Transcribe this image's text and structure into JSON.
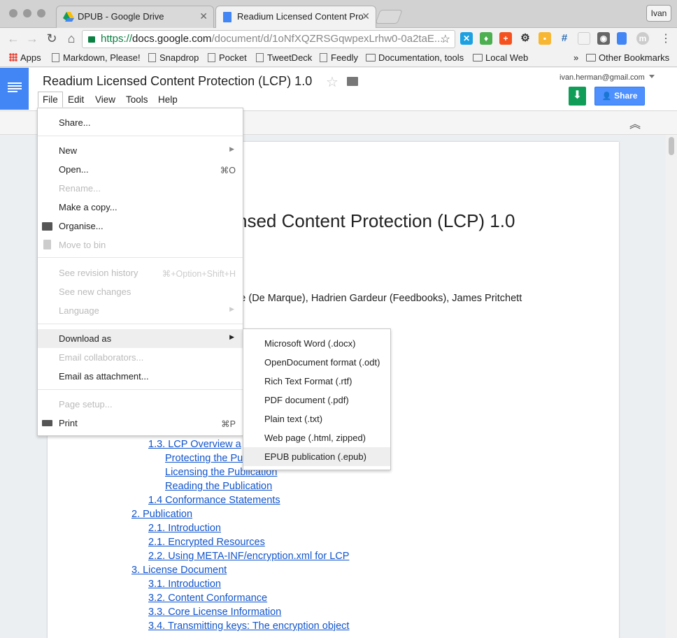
{
  "browser": {
    "tabs": [
      {
        "title": "DPUB - Google Drive"
      },
      {
        "title": "Readium Licensed Content Pro"
      }
    ],
    "user": "Ivan",
    "url": {
      "scheme": "https://",
      "host": "docs.google.com",
      "path": "/document/d/1oNfXQZRSGqwpexLrhw0-0a2taE..."
    },
    "bookmarks": [
      "Apps",
      "Markdown, Please!",
      "Snapdrop",
      "Pocket",
      "TweetDeck",
      "Feedly",
      "Documentation, tools",
      "Local Web"
    ],
    "bookmarks_overflow": "»",
    "other_bookmarks": "Other Bookmarks"
  },
  "docs": {
    "title": "Readium Licensed Content Protection (LCP) 1.0",
    "menus": [
      "File",
      "Edit",
      "View",
      "Tools",
      "Help"
    ],
    "account": "ivan.herman@gmail.com",
    "share_label": "Share"
  },
  "document": {
    "heading": "nsed Content Protection (LCP) 1.0",
    "authors": "gie (De Marque), Hadrien Gardeur (Feedbooks), James Pritchett",
    "toc": [
      "1.3. LCP Overview a",
      "Protecting the Pu",
      "Licensing the Publication",
      "Reading the Publication",
      "1.4 Conformance Statements",
      "2. Publication",
      "2.1. Introduction",
      "2.1. Encrypted Resources",
      "2.2. Using META-INF/encryption.xml for LCP",
      "3. License Document",
      "3.1. Introduction",
      "3.2. Content Conformance",
      "3.3. Core License Information",
      "3.4. Transmitting keys:  The encryption object"
    ]
  },
  "file_menu": {
    "items": [
      {
        "label": "Share...",
        "enabled": true
      },
      {
        "label": "New",
        "enabled": true,
        "submenu": true
      },
      {
        "label": "Open...",
        "enabled": true,
        "shortcut": "⌘O"
      },
      {
        "label": "Rename...",
        "enabled": false
      },
      {
        "label": "Make a copy...",
        "enabled": true
      },
      {
        "label": "Organise...",
        "enabled": true,
        "icon": "folder-icon"
      },
      {
        "label": "Move to bin",
        "enabled": false,
        "icon": "trash-icon"
      },
      {
        "label": "See revision history",
        "enabled": false,
        "shortcut": "⌘+Option+Shift+H"
      },
      {
        "label": "See new changes",
        "enabled": false
      },
      {
        "label": "Language",
        "enabled": false,
        "submenu": true
      },
      {
        "label": "Download as",
        "enabled": true,
        "submenu": true,
        "highlighted": true
      },
      {
        "label": "Email collaborators...",
        "enabled": false
      },
      {
        "label": "Email as attachment...",
        "enabled": true
      },
      {
        "label": "Page setup...",
        "enabled": false
      },
      {
        "label": "Print",
        "enabled": true,
        "shortcut": "⌘P",
        "icon": "printer-icon"
      }
    ]
  },
  "download_menu": {
    "items": [
      "Microsoft Word (.docx)",
      "OpenDocument format (.odt)",
      "Rich Text Format (.rtf)",
      "PDF document (.pdf)",
      "Plain text (.txt)",
      "Web page (.html, zipped)",
      "EPUB publication (.epub)"
    ],
    "highlighted_index": 6
  },
  "colors": {
    "docs_blue": "#4285f4",
    "link": "#1155cc",
    "share_blue": "#4d90fe",
    "green": "#0f9d58"
  }
}
